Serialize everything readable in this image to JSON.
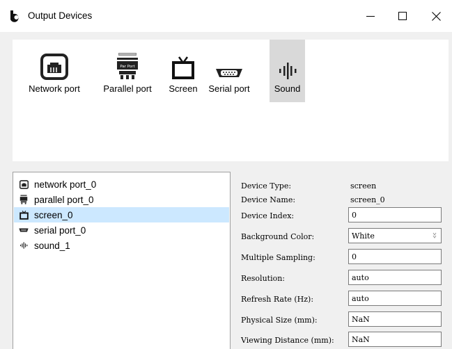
{
  "window": {
    "title": "Output Devices",
    "icon": "app-logo-icon",
    "controls": [
      "minimize-icon",
      "maximize-icon",
      "close-icon"
    ]
  },
  "device_types": [
    {
      "label": "Network port",
      "icon": "network-port-icon"
    },
    {
      "label": "Parallel port",
      "icon": "parallel-port-icon",
      "icon_text": "Par Port"
    },
    {
      "label": "Screen",
      "icon": "screen-icon"
    },
    {
      "label": "Serial port",
      "icon": "serial-port-icon"
    },
    {
      "label": "Sound",
      "icon": "sound-icon",
      "selected": true
    }
  ],
  "devices": [
    {
      "label": "network port_0",
      "icon": "network-port-icon"
    },
    {
      "label": "parallel port_0",
      "icon": "parallel-port-icon"
    },
    {
      "label": "screen_0",
      "icon": "screen-icon",
      "selected": true
    },
    {
      "label": "serial port_0",
      "icon": "serial-port-icon"
    },
    {
      "label": "sound_1",
      "icon": "sound-icon"
    }
  ],
  "properties": {
    "device_type": {
      "label": "Device Type:",
      "value": "screen"
    },
    "device_name": {
      "label": "Device Name:",
      "value": "screen_0"
    },
    "device_index": {
      "label": "Device Index:",
      "value": "0"
    },
    "background_color": {
      "label": "Background Color:",
      "value": "White"
    },
    "multiple_sampling": {
      "label": "Multiple Sampling:",
      "value": "0"
    },
    "resolution": {
      "label": "Resolution:",
      "value": "auto"
    },
    "refresh_rate": {
      "label": "Refresh Rate (Hz):",
      "value": "auto"
    },
    "physical_size": {
      "label": "Physical Size (mm):",
      "value": "NaN"
    },
    "viewing_distance": {
      "label": "Viewing Distance (mm):",
      "value": "NaN"
    }
  },
  "colors": {
    "selected_list_bg": "#cce8ff",
    "selected_icon_bg": "#d9d9d9",
    "window_bg": "#f0f0f0"
  }
}
